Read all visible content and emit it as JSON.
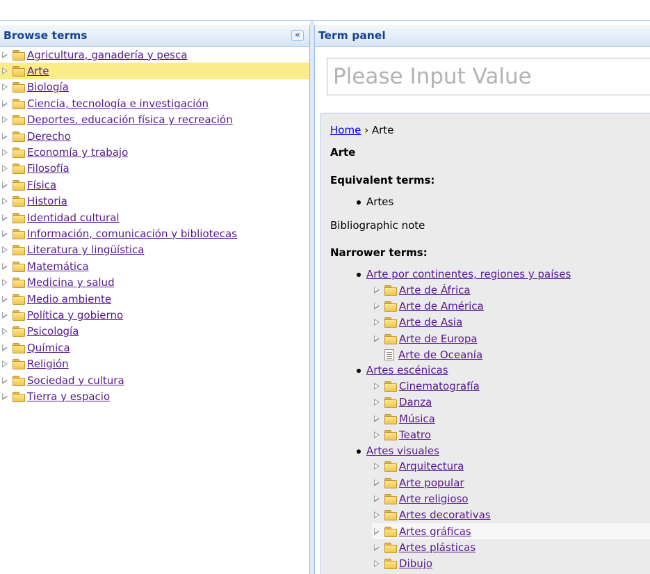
{
  "left_panel": {
    "title": "Browse terms",
    "collapse_icon": "double-chevron-left-icon",
    "items": [
      {
        "label": "Agricultura, ganadería y pesca"
      },
      {
        "label": "Arte",
        "selected": true
      },
      {
        "label": "Biología"
      },
      {
        "label": "Ciencia, tecnología e investigación"
      },
      {
        "label": "Deportes, educación física y recreación"
      },
      {
        "label": "Derecho"
      },
      {
        "label": "Economía y trabajo"
      },
      {
        "label": "Filosofía"
      },
      {
        "label": "Física"
      },
      {
        "label": "Historia"
      },
      {
        "label": "Identidad cultural"
      },
      {
        "label": "Información, comunicación y bibliotecas"
      },
      {
        "label": "Literatura y lingüística"
      },
      {
        "label": "Matemática"
      },
      {
        "label": "Medicina y salud"
      },
      {
        "label": "Medio ambiente"
      },
      {
        "label": "Política y gobierno"
      },
      {
        "label": "Psicología"
      },
      {
        "label": "Química"
      },
      {
        "label": "Religión"
      },
      {
        "label": "Sociedad y cultura"
      },
      {
        "label": "Tierra y espacio"
      }
    ]
  },
  "right_panel": {
    "title": "Term panel",
    "search": {
      "placeholder": "Please Input Value",
      "value": ""
    },
    "breadcrumb": {
      "home": "Home",
      "separator": "›",
      "current": "Arte"
    },
    "term": "Arte",
    "equivalent_heading": "Equivalent terms:",
    "equivalent_terms": [
      "Artes"
    ],
    "bibliographic_note": "Bibliographic note",
    "narrower_heading": "Narrower terms:",
    "narrower": [
      {
        "label": "Arte por continentes, regiones y países",
        "children": [
          {
            "label": "Arte de África",
            "type": "folder"
          },
          {
            "label": "Arte de América",
            "type": "folder"
          },
          {
            "label": "Arte de Asia",
            "type": "folder"
          },
          {
            "label": "Arte de Europa",
            "type": "folder"
          },
          {
            "label": "Arte de Oceanía",
            "type": "leaf"
          }
        ]
      },
      {
        "label": "Artes escénicas",
        "children": [
          {
            "label": "Cinematografía",
            "type": "folder"
          },
          {
            "label": "Danza",
            "type": "folder"
          },
          {
            "label": "Música",
            "type": "folder"
          },
          {
            "label": "Teatro",
            "type": "folder"
          }
        ]
      },
      {
        "label": "Artes visuales",
        "children": [
          {
            "label": "Arquitectura",
            "type": "folder"
          },
          {
            "label": "Arte popular",
            "type": "folder"
          },
          {
            "label": "Arte religioso",
            "type": "folder"
          },
          {
            "label": "Artes decorativas",
            "type": "folder"
          },
          {
            "label": "Artes gráficas",
            "type": "folder",
            "hover": true
          },
          {
            "label": "Artes plásticas",
            "type": "folder"
          },
          {
            "label": "Dibujo",
            "type": "folder"
          }
        ]
      }
    ]
  },
  "colors": {
    "header_text": "#15428b",
    "selected_row": "#fbec88",
    "link_visited": "#551a8b",
    "link": "#0000ee",
    "content_bg": "#ebebeb"
  }
}
